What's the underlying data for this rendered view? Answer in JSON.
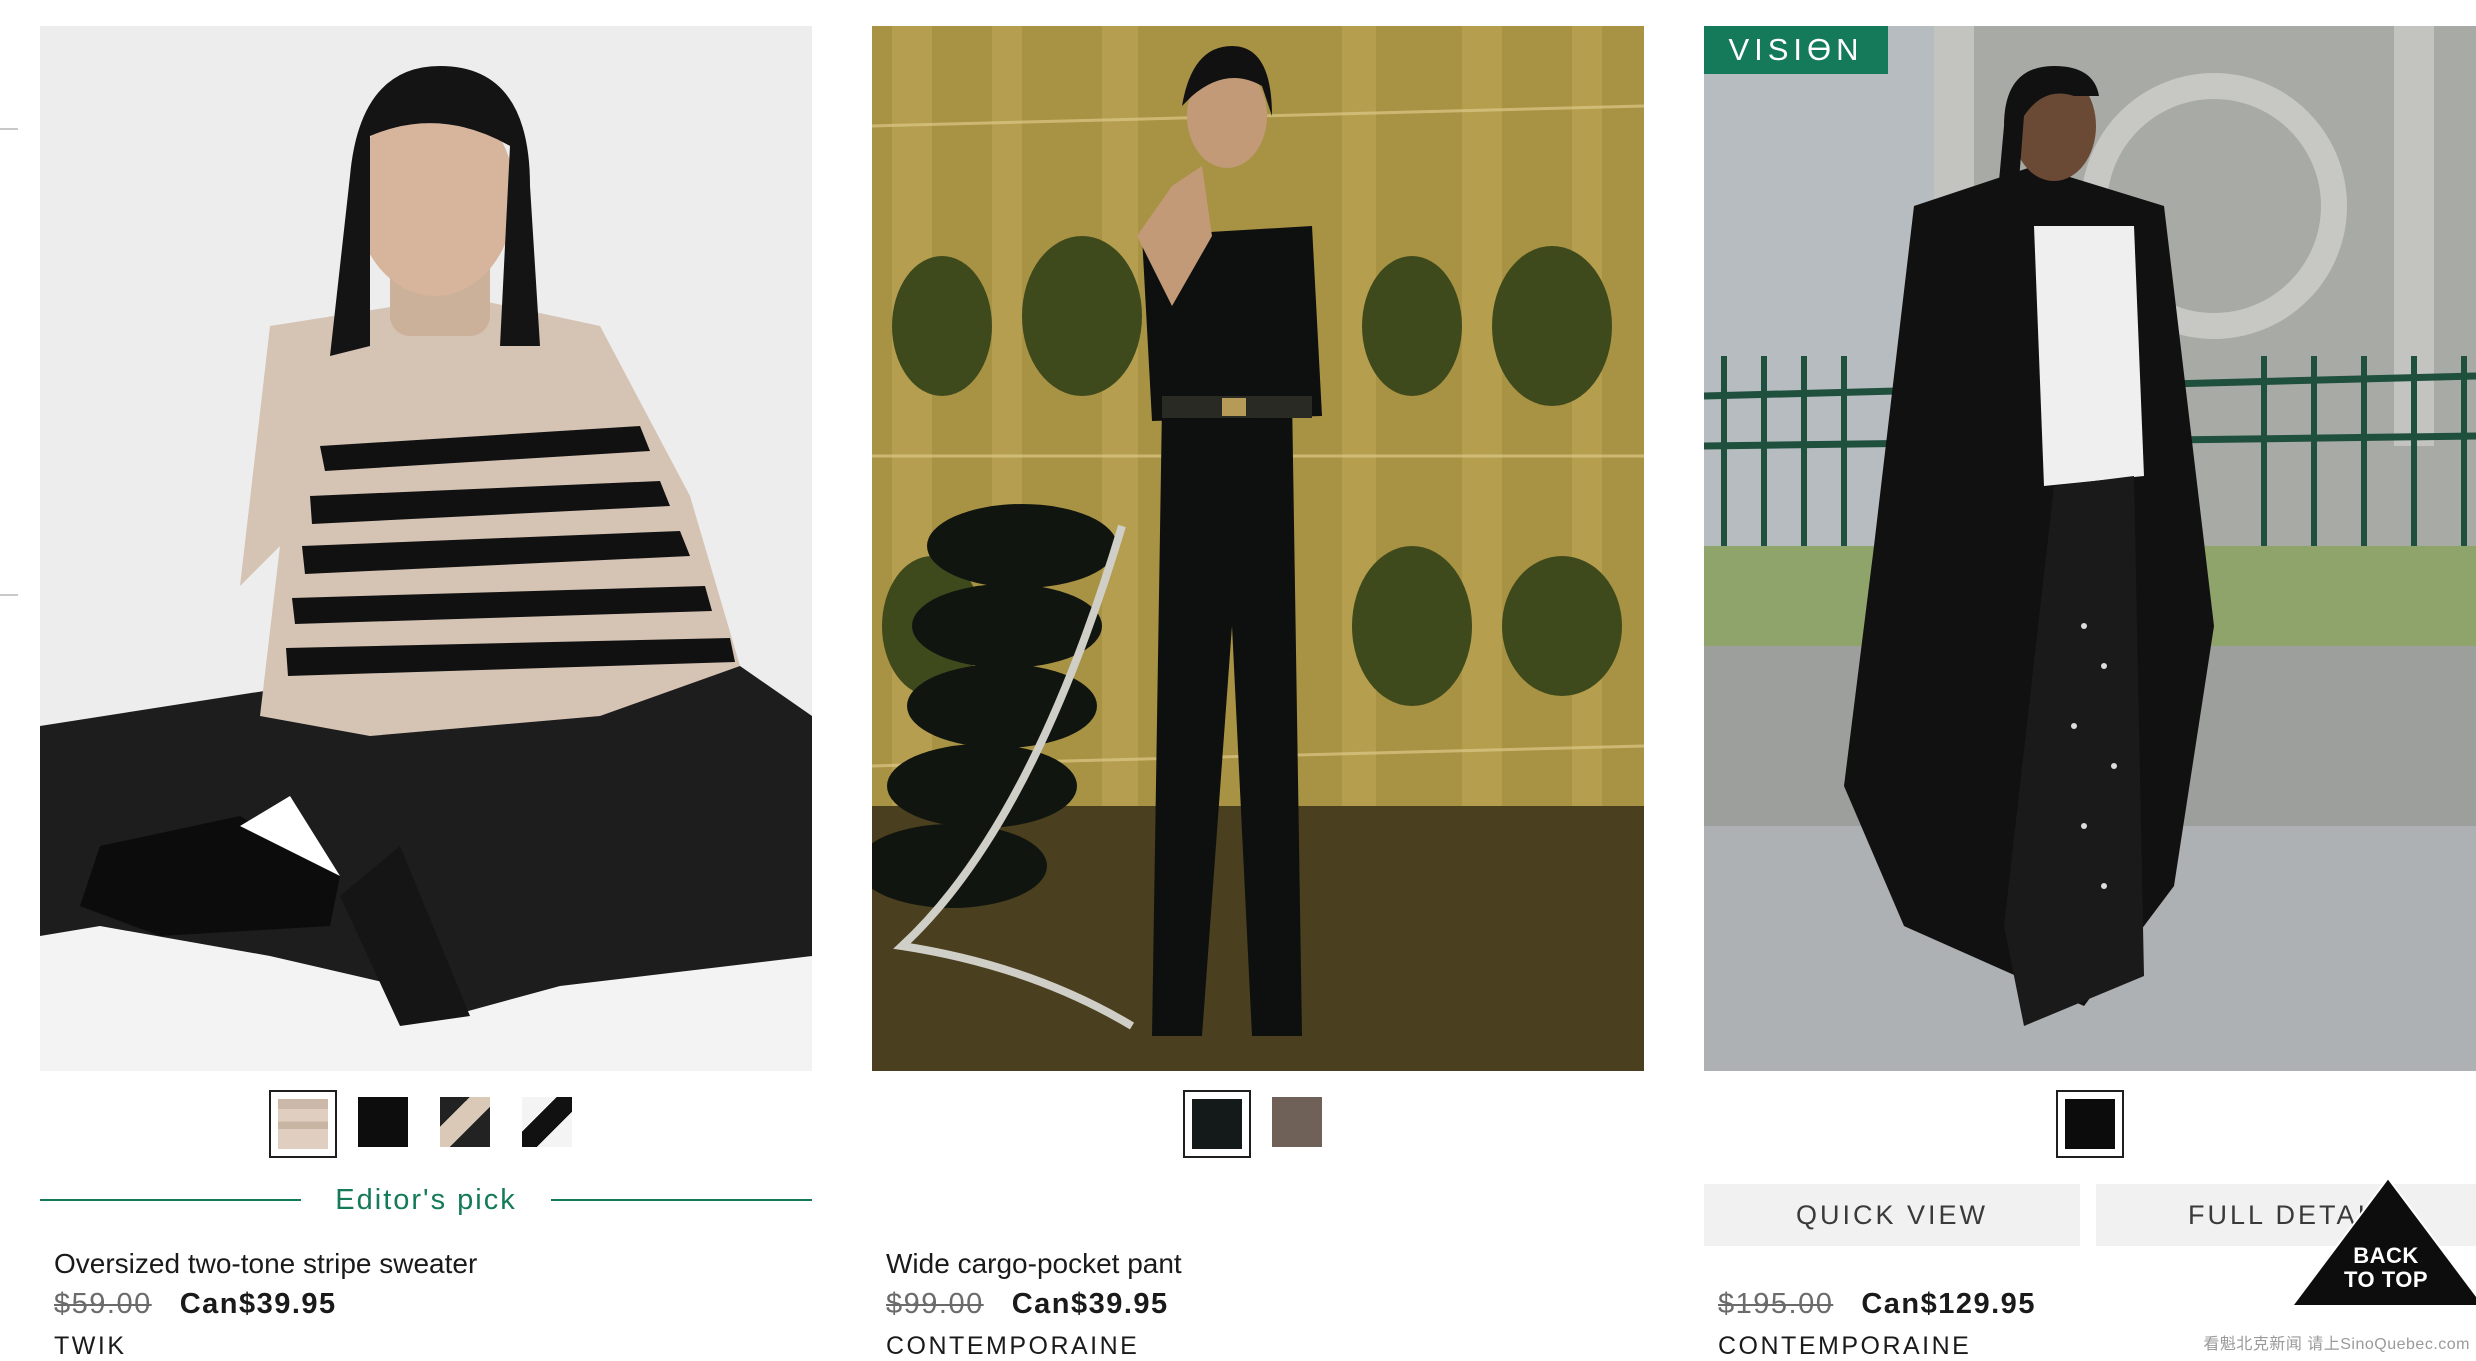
{
  "products": [
    {
      "image_alt": "Model sitting in a beige and black striped sweater with wide black jeans",
      "swatches": [
        {
          "color": "#d8c6b6",
          "selected": true
        },
        {
          "color": "#0d0d0d",
          "selected": false
        },
        {
          "color": "#2a2a2a",
          "selected": false
        },
        {
          "color": "#f4f4f4",
          "selected": false
        }
      ],
      "editor_pick": "Editor's pick",
      "name": "Oversized two-tone stripe sweater",
      "old_price": "$59.00",
      "price": "Can$39.95",
      "brand": "TWIK"
    },
    {
      "image_alt": "Model standing in a black tank top and wide black pants beside a tufted chair",
      "swatches": [
        {
          "color": "#14191a",
          "selected": true
        },
        {
          "color": "#6f6158",
          "selected": false
        }
      ],
      "name": "Wide cargo-pocket pant",
      "old_price": "$99.00",
      "price": "Can$39.95",
      "brand": "CONTEMPORAINE"
    },
    {
      "image_alt": "Model walking outdoors in a long black trench coat and polka dot skirt",
      "badge": "VISIϴN",
      "swatches": [
        {
          "color": "#0c0c0c",
          "selected": true
        }
      ],
      "quick_view": "QUICK VIEW",
      "full_details": "FULL DETAILS",
      "old_price": "$195.00",
      "price": "Can$129.95",
      "brand": "CONTEMPORAINE"
    }
  ],
  "back_to_top": {
    "line1": "BACK",
    "line2": "TO TOP"
  },
  "watermark": "看魁北克新闻 请上SinoQuebec.com",
  "colors": {
    "accent_green": "#157a5a",
    "text": "#1a1a1a",
    "muted": "#6b6b6b"
  }
}
